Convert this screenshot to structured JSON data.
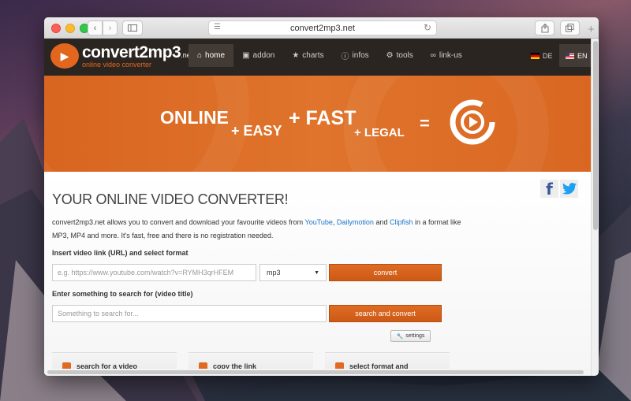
{
  "browser": {
    "url": "convert2mp3.net",
    "nav_back": "‹",
    "nav_forward": "›",
    "new_tab": "+"
  },
  "site": {
    "logo": {
      "name": "convert2mp3",
      "tld": ".net",
      "tagline": "online video converter"
    },
    "menu": [
      {
        "label": "home",
        "icon": "home-icon",
        "active": true
      },
      {
        "label": "addon",
        "icon": "addon-icon",
        "active": false
      },
      {
        "label": "charts",
        "icon": "star-icon",
        "active": false
      },
      {
        "label": "infos",
        "icon": "info-icon",
        "active": false
      },
      {
        "label": "tools",
        "icon": "gear-icon",
        "active": false
      },
      {
        "label": "link-us",
        "icon": "link-icon",
        "active": false
      }
    ],
    "languages": [
      {
        "label": "DE",
        "active": false
      },
      {
        "label": "EN",
        "active": true
      }
    ]
  },
  "banner": {
    "online": "ONLINE",
    "easy": "+ EASY",
    "fast": "+ FAST",
    "legal": "+ LEGAL",
    "equals": "="
  },
  "main": {
    "title": "YOUR ONLINE VIDEO CONVERTER!",
    "intro_before": "convert2mp3.net allows you to convert and download your favourite videos from ",
    "link_youtube": "YouTube",
    "comma": ", ",
    "link_dailymotion": "Dailymotion",
    "and": " and ",
    "link_clipfish": "Clipfish",
    "intro_after": " in a format like MP3, MP4 and more. It's fast, free and there is no registration needed.",
    "label_url": "Insert video link (URL) and select format",
    "url_placeholder": "e.g. https://www.youtube.com/watch?v=RYMH3qrHFEM",
    "format_value": "mp3",
    "convert_label": "convert",
    "label_search": "Enter something to search for (video title)",
    "search_placeholder": "Something to search for...",
    "search_convert_label": "search and convert",
    "settings_label": "settings",
    "steps": [
      {
        "label": "search for a video"
      },
      {
        "label": "copy the link"
      },
      {
        "label": "select format and"
      }
    ]
  },
  "colors": {
    "accent": "#e06a22",
    "nav_bg": "#2b2521",
    "link": "#1a73c8"
  }
}
